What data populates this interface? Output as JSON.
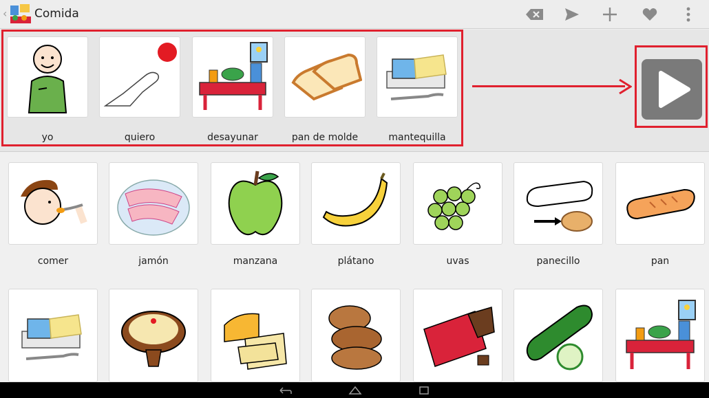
{
  "app": {
    "title": "Comida"
  },
  "toolbar": [
    "backspace-icon",
    "send-icon",
    "add-icon",
    "heart-icon",
    "overflow-menu-icon"
  ],
  "sentence": [
    {
      "label": "yo",
      "icon": "person-pointing-self-icon"
    },
    {
      "label": "quiero",
      "icon": "hand-reaching-red-ball-icon"
    },
    {
      "label": "desayunar",
      "icon": "breakfast-table-icon"
    },
    {
      "label": "pan de molde",
      "icon": "sliced-bread-icon"
    },
    {
      "label": "mantequilla",
      "icon": "butter-icon"
    }
  ],
  "grid": [
    {
      "label": "comer",
      "icon": "boy-eating-icon"
    },
    {
      "label": "jamón",
      "icon": "ham-plate-icon"
    },
    {
      "label": "manzana",
      "icon": "green-apple-icon"
    },
    {
      "label": "plátano",
      "icon": "banana-icon"
    },
    {
      "label": "uvas",
      "icon": "grapes-icon"
    },
    {
      "label": "panecillo",
      "icon": "bread-roll-icon"
    },
    {
      "label": "pan",
      "icon": "bread-loaf-icon"
    },
    {
      "label": "",
      "icon": "butter-icon"
    },
    {
      "label": "",
      "icon": "cake-icon"
    },
    {
      "label": "",
      "icon": "cheese-icon"
    },
    {
      "label": "",
      "icon": "cookies-icon"
    },
    {
      "label": "",
      "icon": "chocolate-icon"
    },
    {
      "label": "",
      "icon": "cucumber-icon"
    },
    {
      "label": "",
      "icon": "breakfast-table-icon"
    }
  ],
  "colors": {
    "highlight": "#e0202e",
    "play_button": "#7a7a7a"
  }
}
